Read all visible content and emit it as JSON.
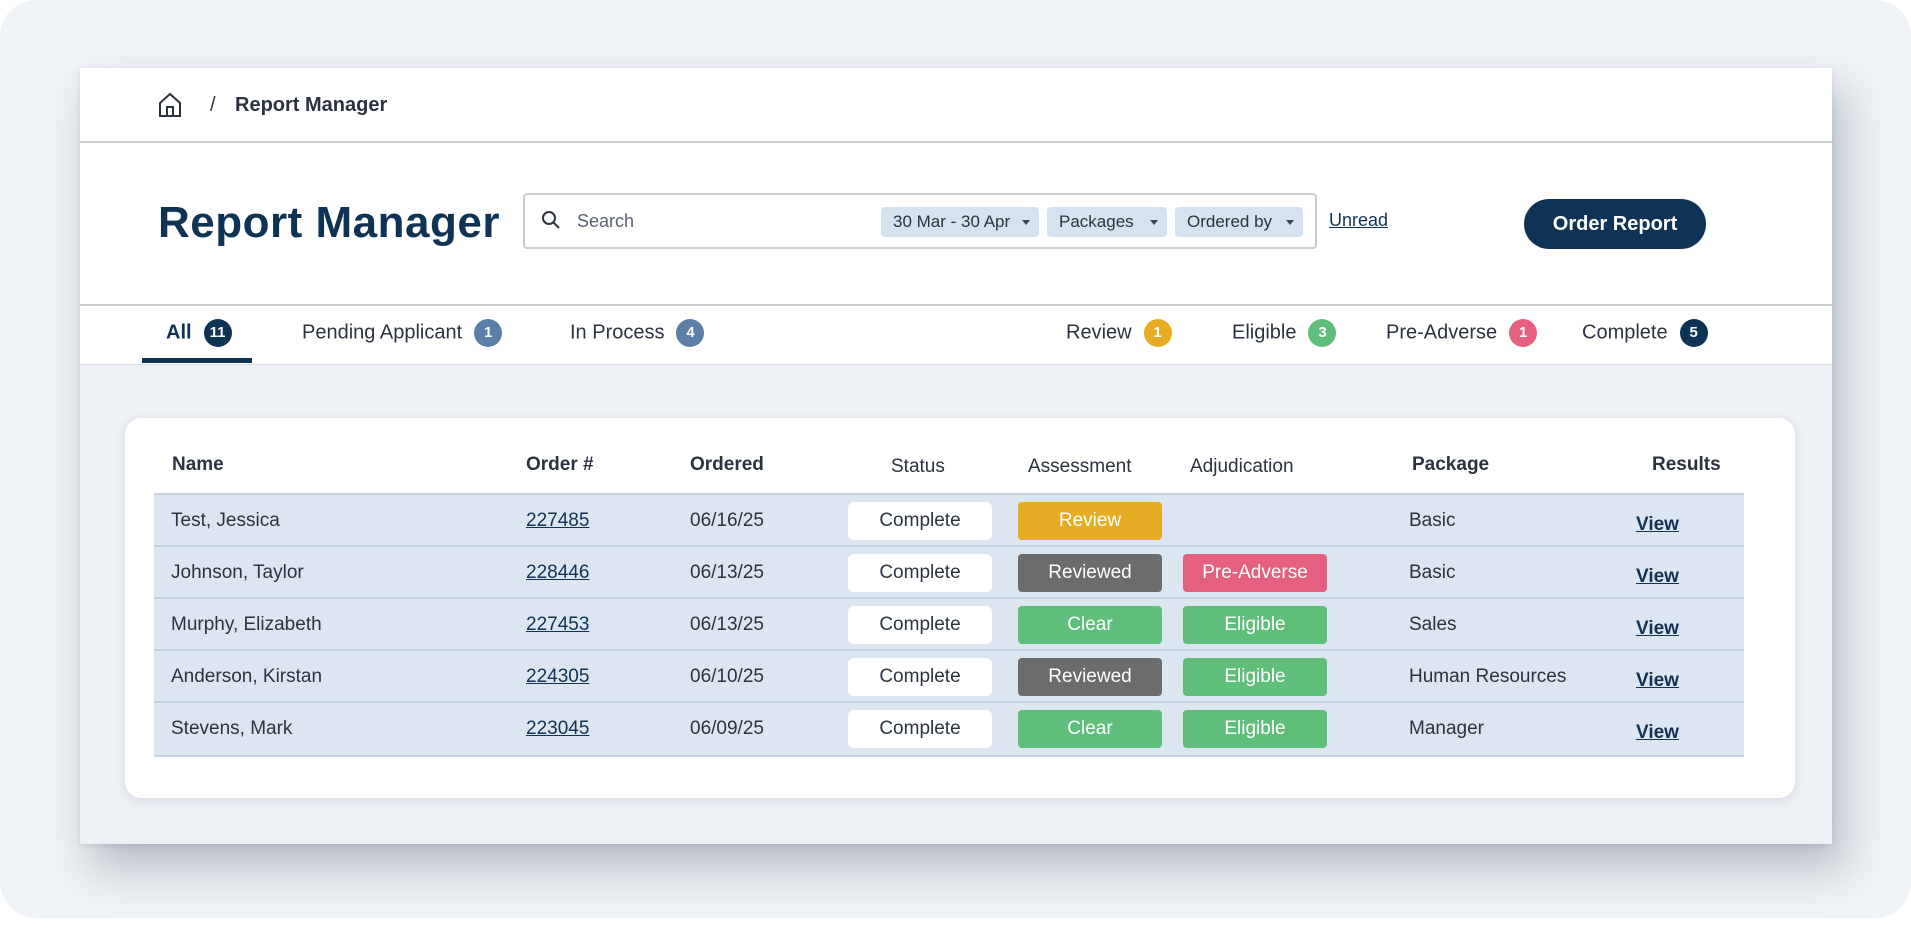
{
  "breadcrumb": {
    "separator": "/",
    "current": "Report Manager",
    "home_icon": "home-icon"
  },
  "header": {
    "title": "Report Manager",
    "search": {
      "placeholder": "Search",
      "value": "",
      "icon": "search-icon"
    },
    "filters": {
      "date_range": "30 Mar - 30 Apr",
      "packages": "Packages",
      "ordered_by": "Ordered by"
    },
    "unread_label": "Unread",
    "order_button_label": "Order Report"
  },
  "tabs": [
    {
      "label": "All",
      "count": "11",
      "color": "#0f3354",
      "active": true
    },
    {
      "label": "Pending Applicant",
      "count": "1",
      "color": "#5b7fa6"
    },
    {
      "label": "In Process",
      "count": "4",
      "color": "#5b7fa6"
    },
    {
      "label": "Review",
      "count": "1",
      "color": "#e5ac24"
    },
    {
      "label": "Eligible",
      "count": "3",
      "color": "#5fbf7a"
    },
    {
      "label": "Pre-Adverse",
      "count": "1",
      "color": "#e5607f"
    },
    {
      "label": "Complete",
      "count": "5",
      "color": "#0f3354"
    }
  ],
  "table": {
    "columns": {
      "name": "Name",
      "order": "Order #",
      "ordered": "Ordered",
      "status": "Status",
      "assessment": "Assessment",
      "adjudication": "Adjudication",
      "package": "Package",
      "results": "Results"
    },
    "rows": [
      {
        "name": "Test, Jessica",
        "order": "227485",
        "ordered": "06/16/25",
        "status": "Complete",
        "assessment": "Review",
        "adjudication": "",
        "package": "Basic",
        "results": "View"
      },
      {
        "name": "Johnson, Taylor",
        "order": "228446",
        "ordered": "06/13/25",
        "status": "Complete",
        "assessment": "Reviewed",
        "adjudication": "Pre-Adverse",
        "package": "Basic",
        "results": "View"
      },
      {
        "name": "Murphy, Elizabeth",
        "order": "227453",
        "ordered": "06/13/25",
        "status": "Complete",
        "assessment": "Clear",
        "adjudication": "Eligible",
        "package": "Sales",
        "results": "View"
      },
      {
        "name": "Anderson, Kirstan",
        "order": "224305",
        "ordered": "06/10/25",
        "status": "Complete",
        "assessment": "Reviewed",
        "adjudication": "Eligible",
        "package": "Human Resources",
        "results": "View"
      },
      {
        "name": "Stevens, Mark",
        "order": "223045",
        "ordered": "06/09/25",
        "status": "Complete",
        "assessment": "Clear",
        "adjudication": "Eligible",
        "package": "Manager",
        "results": "View"
      }
    ]
  },
  "colors": {
    "brand": "#0f3354",
    "review": "#e5ac24",
    "reviewed": "#6b6c6e",
    "clear": "#5fbf7a",
    "eligible": "#5fbf7a",
    "pre_adverse": "#e5607f",
    "row_bg": "#dce6f1"
  }
}
